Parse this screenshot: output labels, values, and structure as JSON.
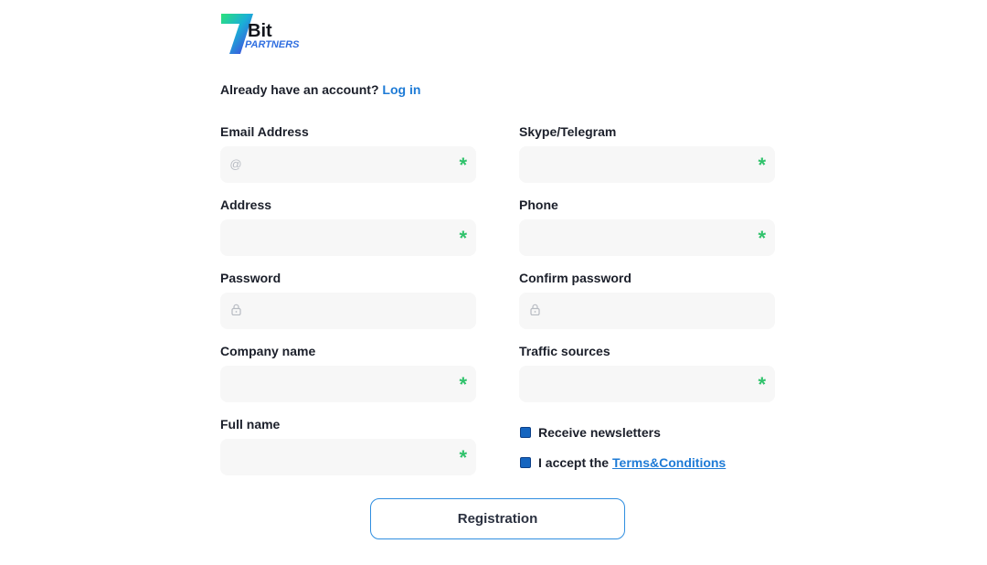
{
  "brand": {
    "logo_numeral": "7",
    "logo_word": "Bit",
    "logo_sub": "PARTNERS",
    "accent": "#1e7bd6",
    "required_color": "#2fc26b"
  },
  "login": {
    "prompt": "Already have an account?",
    "link": "Log in"
  },
  "fields": {
    "email": {
      "label": "Email Address",
      "value": "",
      "icon": "at-icon",
      "required": true
    },
    "skype": {
      "label": "Skype/Telegram",
      "value": "",
      "required": true
    },
    "address": {
      "label": "Address",
      "value": "",
      "required": true
    },
    "phone": {
      "label": "Phone",
      "value": "",
      "required": true
    },
    "password": {
      "label": "Password",
      "value": "",
      "icon": "lock-icon",
      "required": false
    },
    "confirm_password": {
      "label": "Confirm password",
      "value": "",
      "icon": "lock-icon",
      "required": false
    },
    "company": {
      "label": "Company name",
      "value": "",
      "required": true
    },
    "traffic": {
      "label": "Traffic sources",
      "value": "",
      "required": true
    },
    "full_name": {
      "label": "Full name",
      "value": "",
      "required": true
    }
  },
  "required_mark": "*",
  "icons": {
    "at": "@"
  },
  "options": {
    "newsletter": {
      "label": "Receive newsletters",
      "checked": true
    },
    "terms": {
      "label": "I accept the",
      "link": "Terms&Conditions",
      "checked": true
    }
  },
  "submit": {
    "label": "Registration"
  }
}
